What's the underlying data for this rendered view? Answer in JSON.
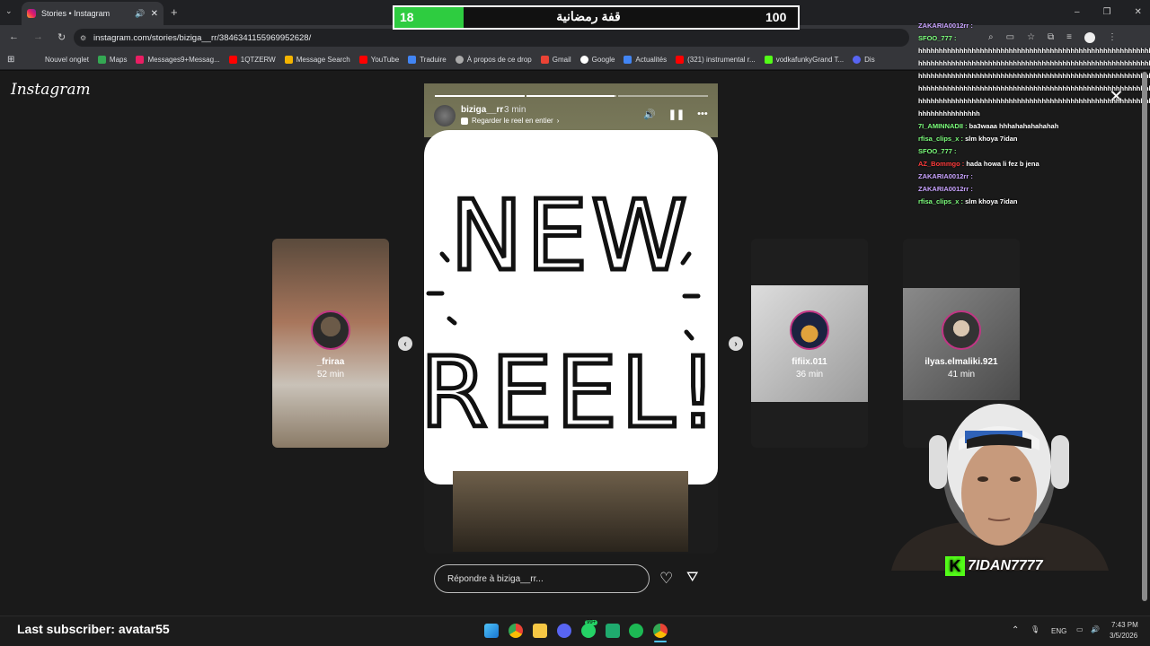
{
  "browser": {
    "tab_title": "Stories • Instagram",
    "url": "instagram.com/stories/biziga__rr/3846341155969952628/",
    "bookmarks": [
      "Nouvel onglet",
      "Maps",
      "Messages9+Messag...",
      "1QTZERW",
      "Message Search",
      "YouTube",
      "Traduire",
      "À propos de ce drop",
      "Gmail",
      "Google",
      "Actualités",
      "(321) instrumental r...",
      "vodkafunkyGrand T...",
      "Dis"
    ]
  },
  "instagram": {
    "logo": "Instagram",
    "story": {
      "username": "biziga__rr",
      "time": "3 min",
      "subtitle": "Regarder le reel en entier",
      "reel_line1": "NEW",
      "reel_line2": "REEL!",
      "reply_placeholder": "Répondre à biziga__rr..."
    },
    "side_stories": [
      {
        "name": "_friraa",
        "time": "52 min"
      },
      {
        "name": "fifiix.011",
        "time": "36 min"
      },
      {
        "name": "ilyas.elmaliki.921",
        "time": "41 min"
      }
    ]
  },
  "stream": {
    "goal_current": "18",
    "goal_title": "قفة رمضانية",
    "goal_target": "100",
    "goal_fraction": 0.18,
    "webcam_name": "7IDAN7777",
    "last_subscriber": "Last subscriber: avatar55",
    "chat": [
      {
        "user": "ZAKARIA0012rr :",
        "text": "",
        "color": "#c9a3ff"
      },
      {
        "user": "SFOO_777 :",
        "text": "",
        "color": "#7cff7c"
      },
      {
        "user": "",
        "text": "hhhhhhhhhhhhhhhhhhhhhhhhhhhhhhhhhhhhhhhhhhhhhhhhhhhhhhhhhhhhhhh",
        "color": "#ffffff"
      },
      {
        "user": "",
        "text": "hhhhhhhhhhhhhhhhhhhhhhhhhhhhhhhhhhhhhhhhhhhhhhhhhhhhhhhhhhhhhhh",
        "color": "#ffffff"
      },
      {
        "user": "",
        "text": "hhhhhhhhhhhhhhhhhhhhhhhhhhhhhhhhhhhhhhhhhhhhhhhhhhhhhhhhhhhhhhh",
        "color": "#ffffff"
      },
      {
        "user": "",
        "text": "hhhhhhhhhhhhhhhhhhhhhhhhhhhhhhhhhhhhhhhhhhhhhhhhhhhhhhhhhhhhhhh",
        "color": "#ffffff"
      },
      {
        "user": "",
        "text": "hhhhhhhhhhhhhhhhhhhhhhhhhhhhhhhhhhhhhhhhhhhhhhhhhhhhhhhhhhhhhhh",
        "color": "#ffffff"
      },
      {
        "user": "",
        "text": "hhhhhhhhhhhhhhh",
        "color": "#ffffff"
      },
      {
        "user": "7I_AMINNADII :",
        "text": "ba3waaa hhhahahahahahah",
        "color": "#7cff7c"
      },
      {
        "user": "rfisa_clips_x :",
        "text": "slm khoya 7idan",
        "color": "#7cff7c"
      },
      {
        "user": "SFOO_777 :",
        "text": "",
        "color": "#7cff7c"
      },
      {
        "user": "AZ_Bommgo :",
        "text": "hada howa li fez b jena",
        "color": "#ff3b3b"
      },
      {
        "user": "ZAKARIA0012rr :",
        "text": "",
        "color": "#c9a3ff"
      },
      {
        "user": "ZAKARIA0012rr :",
        "text": "",
        "color": "#c9a3ff"
      },
      {
        "user": "rfisa_clips_x :",
        "text": "slm khoya 7idan",
        "color": "#7cff7c"
      }
    ]
  },
  "taskbar": {
    "lang": "ENG",
    "time": "7:43 PM",
    "date": "3/5/2026",
    "badge": "99+"
  }
}
